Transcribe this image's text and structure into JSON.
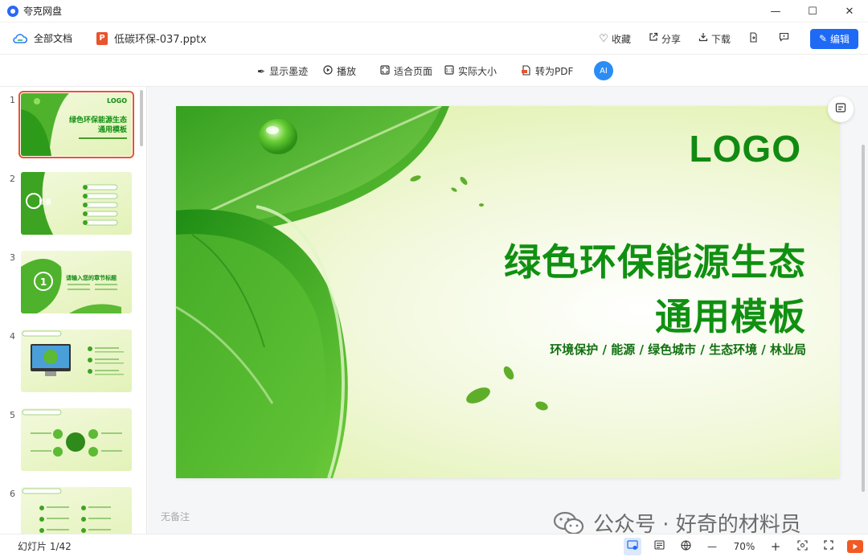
{
  "app": {
    "title": "夸克网盘"
  },
  "window": {
    "minimize": "—",
    "maximize": "☐",
    "close": "✕"
  },
  "docbar": {
    "all_docs": "全部文档",
    "file_icon_letter": "P",
    "filename": "低碳环保-037.pptx",
    "actions": {
      "favorite": "收藏",
      "share": "分享",
      "download": "下载"
    },
    "edit": "编辑"
  },
  "toolbar": {
    "show_ink": "显示墨迹",
    "play": "播放",
    "fit_page": "适合页面",
    "actual_size": "实际大小",
    "to_pdf": "转为PDF",
    "ai": "AI"
  },
  "thumbnails": [
    {
      "num": "1",
      "title": "绿色环保能源生态",
      "title2": "通用模板"
    },
    {
      "num": "2",
      "title": "目录"
    },
    {
      "num": "3",
      "title": "请输入您的章节标题",
      "badge": "1"
    },
    {
      "num": "4",
      "title": ""
    },
    {
      "num": "5",
      "title": ""
    },
    {
      "num": "6",
      "title": ""
    }
  ],
  "slide": {
    "logo": "LOGO",
    "title_line1": "绿色环保能源生态",
    "title_line2": "通用模板",
    "subtitle": "环境保护 / 能源 / 绿色城市 / 生态环境 / 林业局"
  },
  "notes": "无备注",
  "watermark": "公众号 · 好奇的材料员",
  "status": {
    "slide_count": "幻灯片 1/42",
    "zoom": "70%"
  },
  "colors": {
    "accent": "#1e6af5",
    "slide_green": "#109011",
    "ppt_orange": "#e8542d"
  }
}
